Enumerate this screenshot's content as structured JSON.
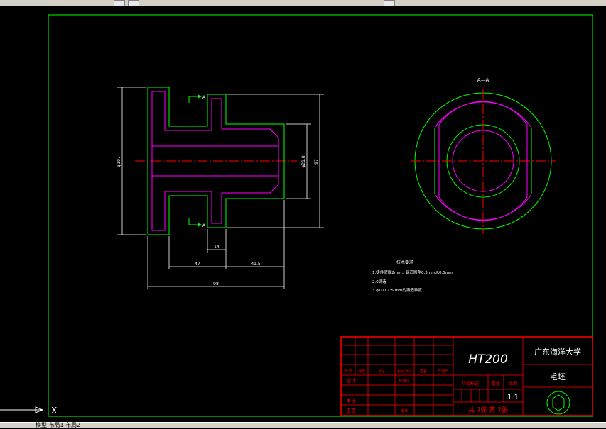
{
  "drawing": {
    "section_label": "A—A",
    "cut_marker_label": "A",
    "dimensions": {
      "left_diameter": "φ107",
      "right_height": "97",
      "bore_diameter": "φ21.8",
      "flange_width": "14",
      "left_span": "47",
      "right_span": "41.5",
      "total_length": "98"
    },
    "tech_requirements": {
      "title": "技术要求",
      "line1": "1.铸件壁厚2mm，铸造圆角0.3mm,R0.5mm",
      "line2": "2.0铸造",
      "line3": "3.φ100 1:5 mm的铸造锥度"
    }
  },
  "title_block": {
    "material": "HT200",
    "school": "广东海洋大学",
    "part_name": "毛坯",
    "scale": "1:1",
    "sheets": "共 7张  第 7张",
    "headers": [
      "标记",
      "处数",
      "分区",
      "更改文件号",
      "签名",
      "年月日"
    ],
    "row_design": "设计",
    "row_standard": "标准化",
    "row_review": "审核",
    "row_process": "工艺",
    "row_approve": "批准",
    "stage_label": "阶段标记",
    "weight_label": "重量",
    "scale_label": "比例"
  },
  "ucs_icon_label": "X",
  "status": {
    "tabs_text": "模型 布局1 布局2"
  },
  "colors": {
    "background": "#000000",
    "frame": "#00ff00",
    "outline": "#00ff00",
    "hidden": "#ff00ff",
    "center": "#ff0000",
    "dimension": "#ffffff",
    "title_block": "#ff0000"
  }
}
